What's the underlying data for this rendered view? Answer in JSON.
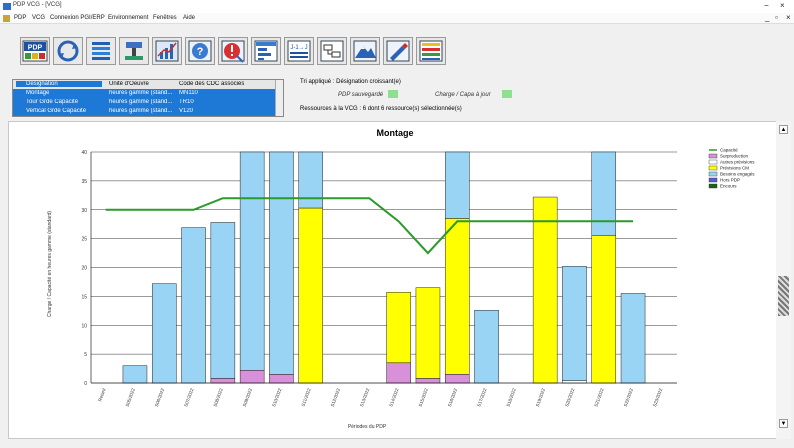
{
  "window": {
    "title": "PDP VCG - [VCG]",
    "controls": [
      "−",
      "×",
      "_",
      "▫",
      "×"
    ]
  },
  "menu": {
    "items": [
      "PDP",
      "VCG",
      "Connexion PGI/ERP",
      "Environnement",
      "Fenêtres",
      "Aide"
    ]
  },
  "toolbar": {
    "buttons": [
      {
        "name": "pdp-icon",
        "label": "PDP"
      },
      {
        "name": "refresh-icon",
        "label": ""
      },
      {
        "name": "list-icon",
        "label": ""
      },
      {
        "name": "tools-icon",
        "label": ""
      },
      {
        "name": "chart-icon",
        "label": ""
      },
      {
        "name": "help-icon",
        "label": ""
      },
      {
        "name": "alert-icon",
        "label": ""
      },
      {
        "name": "table-icon",
        "label": ""
      },
      {
        "name": "calendar-icon",
        "label": "J-1→J"
      },
      {
        "name": "sync-icon",
        "label": ""
      },
      {
        "name": "mountain-icon",
        "label": ""
      },
      {
        "name": "edit-icon",
        "label": ""
      },
      {
        "name": "grid-icon",
        "label": ""
      }
    ]
  },
  "resource_list": {
    "columns": [
      "Désignation",
      "Unité d'Oeuvre",
      "Code des CDC associés"
    ],
    "rows": [
      [
        "Montage",
        "heures gamme (stand...",
        "MN110"
      ],
      [
        "Tour Grde Capacité",
        "heures gamme (stand...",
        "TR10"
      ],
      [
        "Vertical Grde Capacité",
        "heures gamme (stand...",
        "V120"
      ]
    ]
  },
  "info": {
    "sort": "Tri appliqué : Désignation croissant(e)",
    "pdp_legend": "PDP sauvegardé",
    "charge_legend": "Charge / Capa à jour",
    "swatch_color": "#8ee08e",
    "resources": "Ressources à la VCG : 6 dont 6 ressource(s) sélectionnée(s)"
  },
  "chart_data": {
    "type": "bar",
    "title": "Montage",
    "ylabel": "Charge / Capacité en heures gamme (standard)",
    "xlabel": "Périodes du PDP",
    "ylim": [
      0,
      40
    ],
    "yticks": [
      0,
      5,
      10,
      15,
      20,
      25,
      30,
      35,
      40
    ],
    "categories": [
      "P01",
      "P02",
      "P03",
      "P04",
      "P05",
      "P06",
      "P07",
      "P08",
      "P09",
      "P10",
      "P11",
      "P12",
      "P13",
      "P14",
      "P15",
      "P16",
      "P17",
      "P18",
      "P19",
      "P20"
    ],
    "category_labels": [
      "Retard",
      "S05/2022",
      "S06/2022",
      "S07/2022",
      "S08/2022",
      "S09/2022",
      "S10/2022",
      "S11/2022",
      "S12/2022",
      "S13/2022",
      "S14/2022",
      "S15/2022",
      "S16/2022",
      "S17/2022",
      "S18/2022",
      "S19/2022",
      "S20/2022",
      "S21/2022",
      "S22/2022",
      "S23/2022"
    ],
    "series": [
      {
        "name": "Surproduction",
        "color": "#d890d8",
        "values": [
          0,
          0,
          0,
          0,
          0.8,
          2.2,
          1.5,
          0,
          0,
          0,
          3.5,
          0.8,
          1.5,
          0,
          0,
          0,
          0,
          0,
          0,
          0
        ]
      },
      {
        "name": "Autres prévisions",
        "color": "#ffffff",
        "values": [
          0,
          0,
          0,
          0,
          0,
          0,
          0,
          0,
          0,
          0,
          0,
          0,
          0,
          0,
          0,
          0,
          0.4,
          0,
          0,
          0
        ]
      },
      {
        "name": "Prévisions CM",
        "color": "#ffff00",
        "values": [
          0,
          0,
          0,
          0,
          0,
          0,
          0,
          30.3,
          0,
          0,
          12.2,
          15.7,
          27,
          0,
          0,
          32.2,
          0,
          25.5,
          0,
          0
        ]
      },
      {
        "name": "Besoins engagés",
        "color": "#9ad4f5",
        "values": [
          0,
          3.0,
          17.2,
          26.9,
          27.0,
          37.8,
          38.5,
          9.7,
          0,
          0,
          0,
          0,
          11.5,
          12.6,
          0,
          0,
          19.8,
          14.5,
          15.5,
          0
        ]
      },
      {
        "name": "Hors PDP",
        "color": "#5a5adc",
        "values": [
          0,
          0,
          0,
          0,
          0,
          0,
          0,
          0,
          0,
          0,
          0,
          0,
          0,
          0,
          0,
          0,
          0,
          0,
          0,
          0
        ]
      },
      {
        "name": "Encours",
        "color": "#176317",
        "values": [
          0,
          0,
          0,
          0,
          0,
          0,
          0,
          0,
          0,
          0,
          0,
          0,
          0,
          0,
          0,
          0,
          0,
          0,
          0,
          0
        ]
      }
    ],
    "capacity": {
      "name": "Capacité",
      "color": "#2a9a2a",
      "values": [
        30,
        30,
        30,
        30,
        32,
        32,
        32,
        32,
        32,
        32,
        28,
        22.5,
        28,
        28,
        28,
        28,
        28,
        28,
        28,
        null
      ]
    },
    "legend": [
      "Capacité",
      "Surproduction",
      "Autres prévisions",
      "Prévisions CM",
      "Besoins engagés",
      "Hors PDP",
      "Encours"
    ],
    "legend_colors": [
      "#2a9a2a",
      "#d890d8",
      "#ffffff",
      "#ffff00",
      "#9ad4f5",
      "#5a5adc",
      "#176317"
    ],
    "legend_position": "right"
  }
}
